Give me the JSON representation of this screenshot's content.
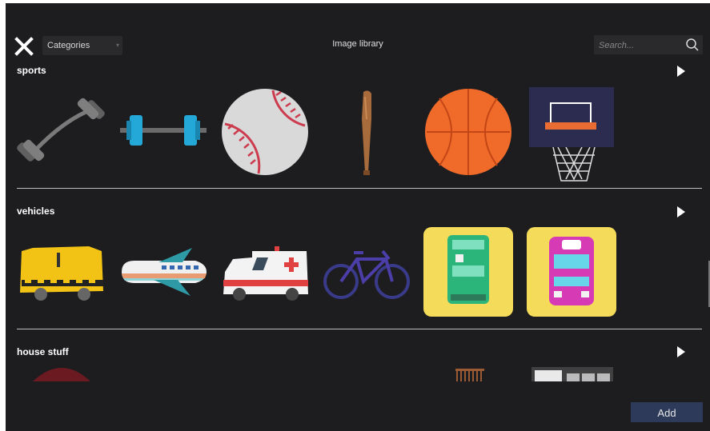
{
  "header": {
    "title": "Image library",
    "categories_label": "Categories",
    "search_placeholder": "Search..."
  },
  "sections": [
    {
      "title": "sports",
      "items": [
        "barbell",
        "dumbbell",
        "baseball",
        "baseball-bat",
        "basketball",
        "basketball-hoop"
      ]
    },
    {
      "title": "vehicles",
      "items": [
        "taxi",
        "airplane",
        "ambulance",
        "bicycle",
        "green-bus",
        "pink-bus"
      ]
    },
    {
      "title": "house stuff",
      "items": [
        "umbrella",
        "comb",
        "cabinet"
      ]
    }
  ],
  "footer": {
    "add_label": "Add"
  },
  "colors": {
    "background": "#1d1d1f",
    "field": "#2a2a2c",
    "add_button": "#2d3a5a",
    "basketball": "#f06a2a"
  }
}
